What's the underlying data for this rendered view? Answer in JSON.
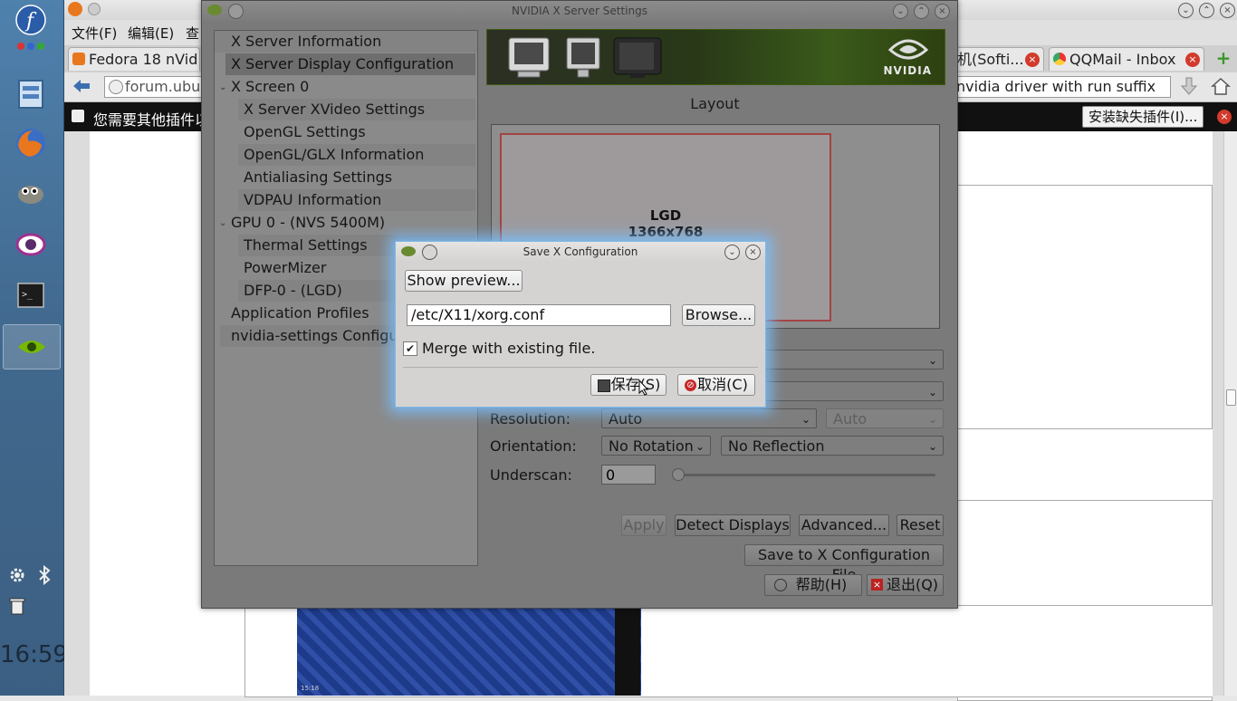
{
  "dock": {
    "icons": [
      "fedora-logo-icon",
      "app-grid-icon",
      "file-manager-icon",
      "firefox-icon",
      "gimp-icon",
      "eye-app-icon",
      "terminal-icon",
      "nvidia-settings-icon"
    ],
    "tray_icons": [
      "settings-gear-icon",
      "bluetooth-icon",
      "trash-icon"
    ],
    "clock": "16:59"
  },
  "browser": {
    "menu": {
      "file": "文件(F)",
      "edit": "编辑(E)",
      "view": "查"
    },
    "tabs": [
      {
        "label": "Fedora 18 nVid..."
      },
      {
        "label": "机(Softi..."
      },
      {
        "label": "QQMail - Inbox"
      }
    ],
    "new_tab_label": "+",
    "url_text": "forum.ubu",
    "search_text": "nvidia driver with run suffix",
    "plugin_bar": {
      "message": "您需要其他插件以",
      "install_button": "安装缺失插件(I)..."
    },
    "bottom_image_time": "15:18"
  },
  "nvidia": {
    "window_title": "NVIDIA X Server Settings",
    "tree": [
      {
        "label": "X Server Information"
      },
      {
        "label": "X Server Display Configuration"
      },
      {
        "label": "X Screen 0"
      },
      {
        "label": "X Server XVideo Settings"
      },
      {
        "label": "OpenGL Settings"
      },
      {
        "label": "OpenGL/GLX Information"
      },
      {
        "label": "Antialiasing Settings"
      },
      {
        "label": "VDPAU Information"
      },
      {
        "label": "GPU 0 - (NVS 5400M)"
      },
      {
        "label": "Thermal Settings"
      },
      {
        "label": "PowerMizer"
      },
      {
        "label": "DFP-0 - (LGD)"
      },
      {
        "label": "Application Profiles"
      },
      {
        "label": "nvidia-settings Configuration"
      }
    ],
    "banner_logo": "NVIDIA",
    "layout_label": "Layout",
    "display": {
      "name": "LGD",
      "resolution": "1366x768"
    },
    "resolution_label": "Resolution:",
    "resolution_value": "Auto",
    "refresh_value": "Auto",
    "orientation_label": "Orientation:",
    "rotation_value": "No Rotation",
    "reflection_value": "No Reflection",
    "underscan_label": "Underscan:",
    "underscan_value": "0",
    "buttons": {
      "apply": "Apply",
      "detect": "Detect Displays",
      "advanced": "Advanced...",
      "reset": "Reset",
      "save_config": "Save to X Configuration File",
      "help": "帮助(H)",
      "quit": "退出(Q)"
    }
  },
  "dialog": {
    "title": "Save X Configuration",
    "show_preview": "Show preview...",
    "path": "/etc/X11/xorg.conf",
    "browse": "Browse...",
    "merge_label": "Merge with existing file.",
    "merge_checked": true,
    "save": "保存(S)",
    "cancel": "取消(C)"
  }
}
